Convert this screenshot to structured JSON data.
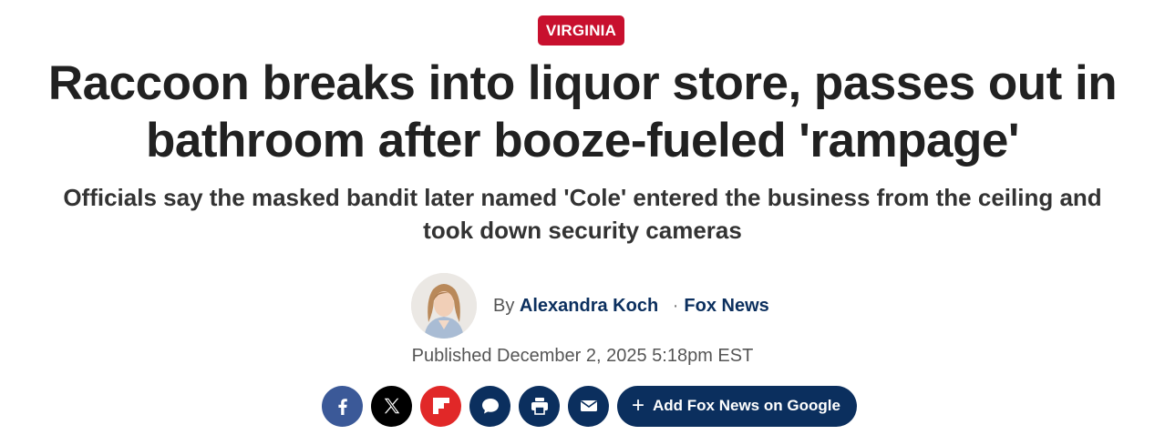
{
  "article": {
    "category": "VIRGINIA",
    "headline": "Raccoon breaks into liquor store, passes out in bathroom after booze-fueled 'rampage'",
    "subheadline": "Officials say the masked bandit later named 'Cole' entered the business from the ceiling and took down security cameras",
    "byline_prefix": "By",
    "author": "Alexandra Koch",
    "separator": "·",
    "outlet": "Fox News",
    "published": "Published December 2, 2025 5:18pm EST"
  },
  "share": {
    "buttons": [
      {
        "name": "facebook",
        "icon": "facebook-icon",
        "color": "#3b5998"
      },
      {
        "name": "x",
        "icon": "x-icon",
        "color": "#000000"
      },
      {
        "name": "flipboard",
        "icon": "flipboard-icon",
        "color": "#e12828"
      },
      {
        "name": "comments",
        "icon": "comment-icon",
        "color": "#0b2f5e"
      },
      {
        "name": "print",
        "icon": "print-icon",
        "color": "#0b2f5e"
      },
      {
        "name": "email",
        "icon": "email-icon",
        "color": "#0b2f5e"
      }
    ],
    "google_label": "Add Fox News on Google",
    "google_icon": "plus-icon"
  },
  "colors": {
    "category_badge": "#c8102e",
    "brand_navy": "#0b2f5e"
  }
}
